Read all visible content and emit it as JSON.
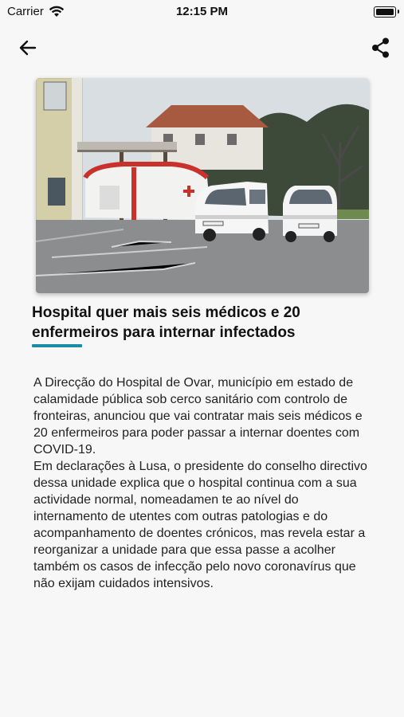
{
  "status_bar": {
    "carrier": "Carrier",
    "time": "12:15 PM",
    "icons": [
      "wifi-icon",
      "battery-icon"
    ]
  },
  "nav": {
    "back_icon": "arrow-left-icon",
    "share_icon": "share-icon"
  },
  "article": {
    "headline": "Hospital quer mais seis médicos e 20 enfermeiros para internar infectados",
    "accent_color": "#1a8ca5",
    "paragraphs": [
      "A Direcção do Hospital de Ovar, município em estado de calamidade pública sob cerco sanitário com controlo de fronteiras, anunciou que vai contratar mais seis médicos e 20 enfermeiros para poder passar a internar doentes com COVID-19.",
      "Em declarações à Lusa, o presidente do conselho directivo dessa unidade explica que o hospital continua com a sua actividade normal, nomeadamen te ao nível do internamento de utentes com outras patologias e do acompanhamento de doentes crónicos, mas revela estar a reorganizar a unidade para que essa passe a acolher também os casos de infecção pelo novo coronavírus que não exijam cuidados intensivos."
    ]
  }
}
